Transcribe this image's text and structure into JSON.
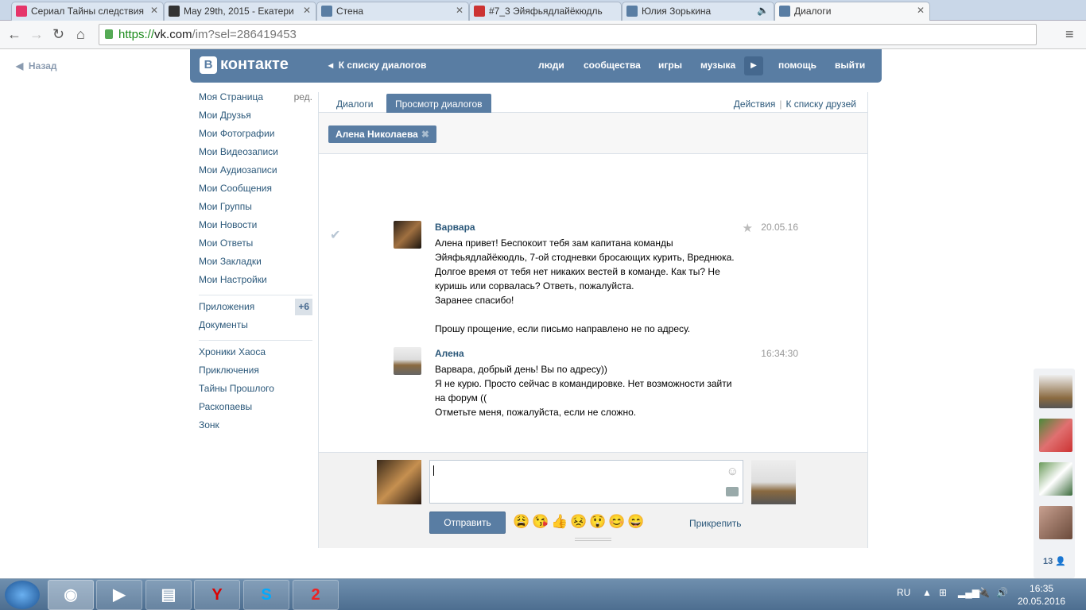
{
  "browser": {
    "tabs": [
      {
        "title": "Сериал Тайны следствия",
        "color": "#e5356a"
      },
      {
        "title": "May 29th, 2015 - Екатери",
        "color": "#333"
      },
      {
        "title": "Стена",
        "color": "#597da3"
      },
      {
        "title": "#7_3 Эйяфьядлайёкюдль",
        "color": "#c33"
      },
      {
        "title": "Юлия Зорькина",
        "color": "#597da3"
      },
      {
        "title": "Диалоги",
        "color": "#597da3"
      }
    ],
    "url_scheme": "https://",
    "url_host": "vk.com",
    "url_path": "/im?sel=286419453"
  },
  "page": {
    "back_label": "Назад",
    "logo": "контакте",
    "logo_letter": "В",
    "header_back": "К списку диалогов",
    "header_links": [
      "люди",
      "сообщества",
      "игры",
      "музыка",
      "помощь",
      "выйти"
    ]
  },
  "sidebar": {
    "items": [
      "Моя Страница",
      "Мои Друзья",
      "Мои Фотографии",
      "Мои Видеозаписи",
      "Мои Аудиозаписи",
      "Мои Сообщения",
      "Мои Группы",
      "Мои Новости",
      "Мои Ответы",
      "Мои Закладки",
      "Мои Настройки"
    ],
    "edit": "ред.",
    "apps": "Приложения",
    "apps_badge": "+6",
    "docs": "Документы",
    "groups": [
      "Хроники Хаоса",
      "Приключения",
      "Тайны Прошлого",
      "Раскопаевы",
      "Зонк"
    ]
  },
  "main": {
    "tabs": [
      "Диалоги",
      "Просмотр диалогов"
    ],
    "actions": "Действия",
    "to_friends": "К списку друзей",
    "chip": "Алена Николаева",
    "messages": [
      {
        "name": "Варвара",
        "date": "20.05.16",
        "text": "Алена привет! Беспокоит тебя зам капитана команды\nЭйяфьядлайёкюдль, 7-ой стодневки бросающих курить, Вреднюка.\nДолгое время от тебя нет никаких вестей в команде. Как ты? Не\nкуришь или сорвалась? Ответь, пожалуйста.\nЗаранее спасибо!\n\nПрошу прощение, если письмо направлено не по адресу."
      },
      {
        "name": "Алена",
        "date": "16:34:30",
        "text": "Варвара, добрый день! Вы по адресу))\nЯ не курю. Просто сейчас в командировке. Нет возможности зайти\nна форум ((\nОтметьте меня, пожалуйста, если не сложно."
      }
    ],
    "send": "Отправить",
    "attach": "Прикрепить",
    "emojis": [
      "😩",
      "😘",
      "👍",
      "😣",
      "😲",
      "😊",
      "😄"
    ]
  },
  "friends": {
    "count": "13"
  },
  "taskbar": {
    "lang": "RU",
    "time": "16:35",
    "date": "20.05.2016",
    "app_label": "2"
  }
}
